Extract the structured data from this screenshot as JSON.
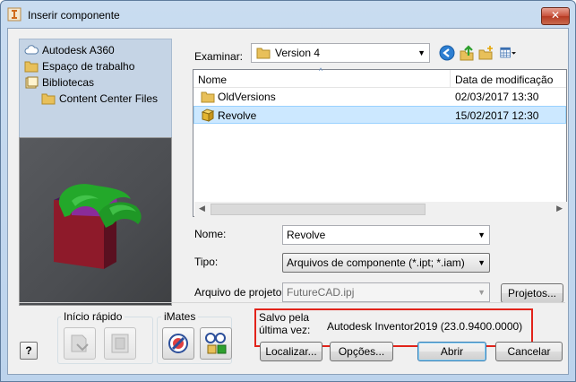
{
  "window": {
    "title": "Inserir componente",
    "close_label": "✕"
  },
  "nav": {
    "items": [
      {
        "label": "Autodesk A360",
        "icon": "cloud-icon"
      },
      {
        "label": "Espaço de trabalho",
        "icon": "folder-icon"
      },
      {
        "label": "Bibliotecas",
        "icon": "libraries-icon"
      },
      {
        "label": "Content Center Files",
        "icon": "folder-icon"
      }
    ]
  },
  "lookin": {
    "label": "Examinar:",
    "value": "Version 4"
  },
  "filelist": {
    "columns": [
      "Nome",
      "Data de modificação"
    ],
    "rows": [
      {
        "name": "OldVersions",
        "date": "02/03/2017 13:30",
        "icon": "folder-icon",
        "selected": false
      },
      {
        "name": "Revolve",
        "date": "15/02/2017 12:30",
        "icon": "part-icon",
        "selected": true
      }
    ]
  },
  "form": {
    "name_label": "Nome:",
    "name_value": "Revolve",
    "type_label": "Tipo:",
    "type_value": "Arquivos de componente (*.ipt; *.iam)",
    "project_label": "Arquivo de projeto:",
    "project_value": "FutureCAD.ipj",
    "projects_button": "Projetos..."
  },
  "quickstart": {
    "title": "Início rápido"
  },
  "imates": {
    "title": "iMates"
  },
  "saved": {
    "label_line1": "Salvo pela",
    "label_line2": "última vez:",
    "value": "Autodesk Inventor2019 (23.0.9400.0000)"
  },
  "buttons": {
    "help": "?",
    "locate": "Localizar...",
    "options": "Opções...",
    "open": "Abrir",
    "cancel": "Cancelar"
  },
  "colors": {
    "accent": "#3c7fb1",
    "highlight_box": "#e2231a",
    "selection": "#cce8ff"
  }
}
